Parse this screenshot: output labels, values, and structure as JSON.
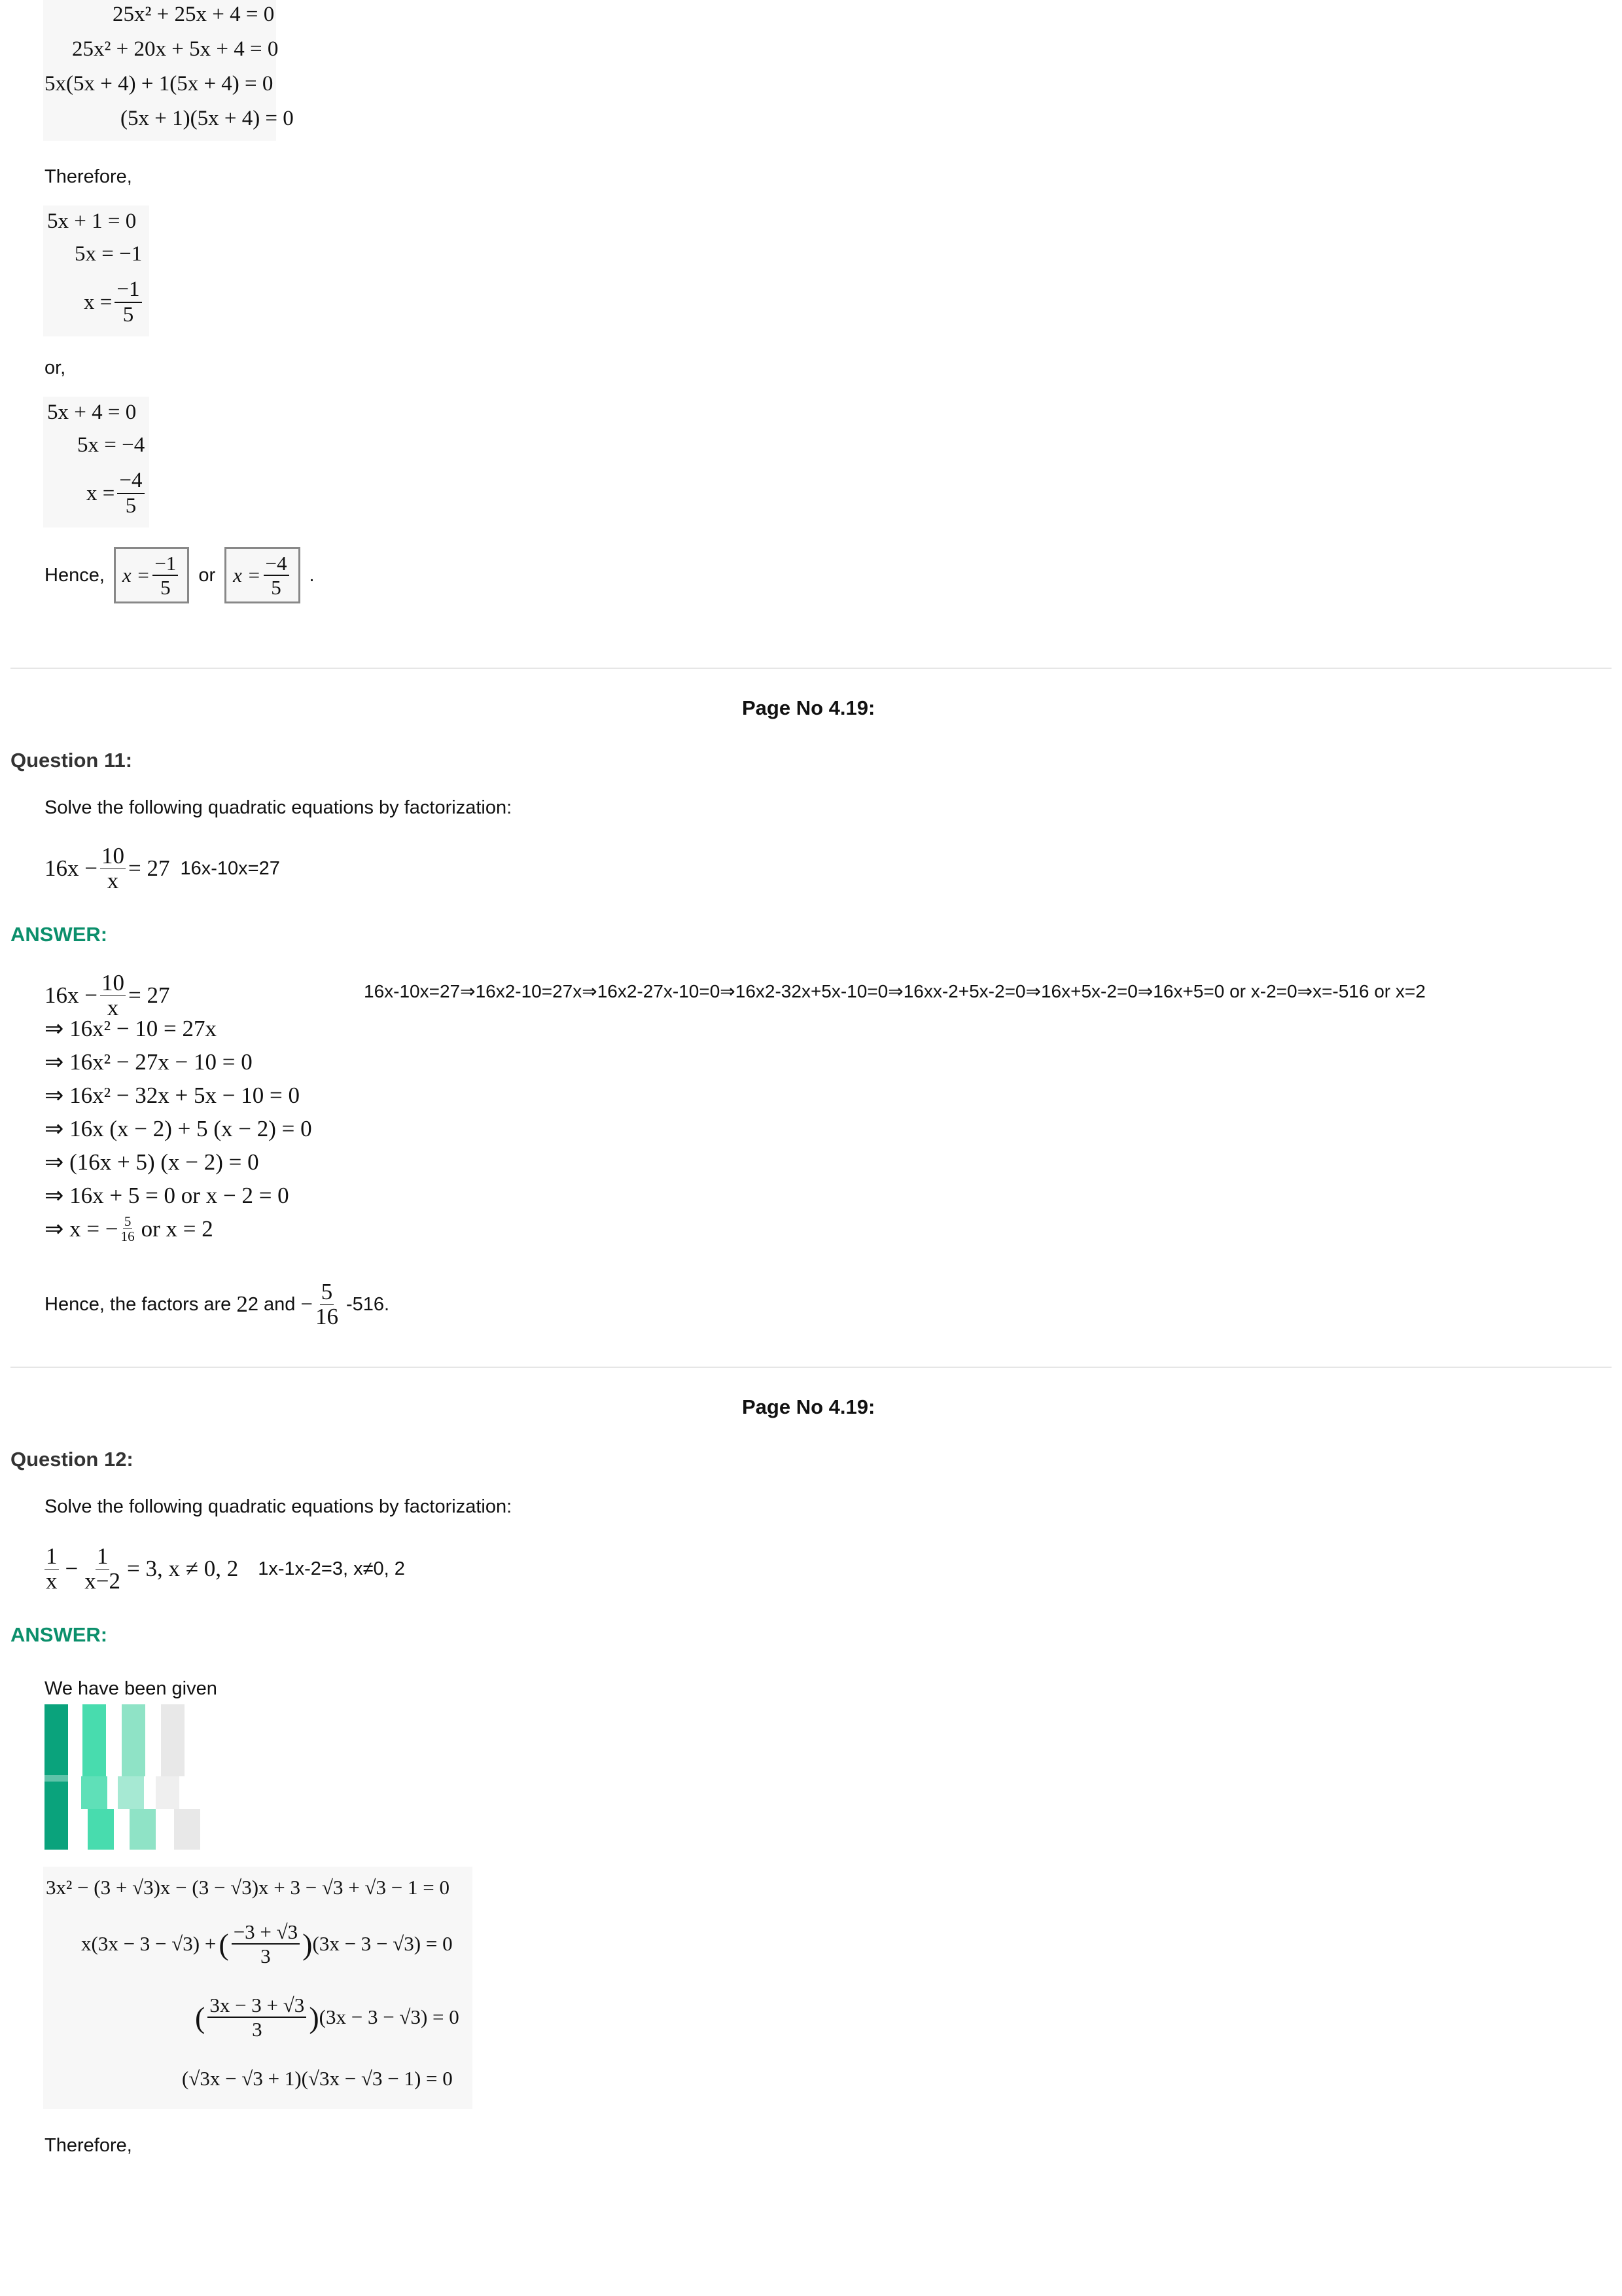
{
  "top_work": {
    "lines": [
      "25x² + 25x + 4 = 0",
      "25x² + 20x + 5x + 4 = 0",
      "5x(5x + 4) + 1(5x + 4) = 0",
      "(5x + 1)(5x + 4) = 0"
    ],
    "therefore": "Therefore,",
    "case1": [
      "5x + 1 = 0",
      "5x = −1",
      "x =",
      "−1",
      "5"
    ],
    "or_text": "or,",
    "case2": [
      "5x + 4 = 0",
      "5x = −4",
      "x =",
      "−4",
      "5"
    ],
    "hence_prefix": "Hence,",
    "hence_or": "or",
    "hence_end": ".",
    "box1": [
      "x =",
      "−1",
      "5"
    ],
    "box2": [
      "x =",
      "−4",
      "5"
    ]
  },
  "q11": {
    "page_no": "Page No 4.19:",
    "heading": "Question 11:",
    "instruction": "Solve the following quadratic equations by factorization:",
    "eq_left": "16x −",
    "eq_num": "10",
    "eq_den": "x",
    "eq_right": "= 27",
    "eq_text": "16x-10x=27",
    "answer_label": "ANSWER:",
    "solution_first_left": "16x −",
    "solution_first_num": "10",
    "solution_first_den": "x",
    "solution_first_right": "= 27",
    "solution_inline": "16x-10x=27⇒16x2-10=27x⇒16x2-27x-10=0⇒16x2-32x+5x-10=0⇒16xx-2+5x-2=0⇒16x+5x-2=0⇒16x+5=0 or x-2=0⇒x=-516 or x=2",
    "steps": [
      "⇒ 16x² − 10 = 27x",
      "⇒ 16x² − 27x − 10 = 0",
      "⇒ 16x² − 32x + 5x − 10 = 0",
      "⇒ 16x (x − 2) + 5 (x − 2) = 0",
      "⇒ (16x + 5) (x − 2) = 0",
      "⇒ 16x + 5 = 0  or  x − 2 = 0"
    ],
    "last_step_prefix": "⇒ x = −",
    "last_step_num": "5",
    "last_step_den": "16",
    "last_step_suffix": "or  x = 2",
    "conclusion_prefix": "Hence, the factors are",
    "conclusion_val1": "2",
    "conclusion_val1_alt": "2",
    "conclusion_and": "and",
    "conclusion_neg": "−",
    "conclusion_num": "5",
    "conclusion_den": "16",
    "conclusion_alt": "-516."
  },
  "q12": {
    "page_no": "Page No 4.19:",
    "heading": "Question 12:",
    "instruction": "Solve the following quadratic equations by factorization:",
    "eq_num1": "1",
    "eq_den1": "x",
    "eq_num2": "1",
    "eq_den2": "x−2",
    "eq_rest": "= 3,  x ≠ 0,  2",
    "eq_text": "1x-1x-2=3, x≠0, 2",
    "answer_label": "ANSWER:",
    "given": "We have been given",
    "work_line1": "3x² − (3 + √3)x − (3 − √3)x + 3 − √3 + √3 − 1 = 0",
    "work_line2_a": "x(3x − 3 − √3) +",
    "work_line2_num": "−3 + √3",
    "work_line2_den": "3",
    "work_line2_b": "(3x − 3 − √3) = 0",
    "work_line3_num": "3x − 3 + √3",
    "work_line3_den": "3",
    "work_line3_b": "(3x − 3 − √3) = 0",
    "work_line4": "(√3x − √3 + 1)(√3x − √3 − 1) = 0",
    "therefore": "Therefore,"
  },
  "colors": {
    "answer_green": "#0b8f6b",
    "teal_dark": "#0aa37c",
    "teal_mid": "#48dcae",
    "teal_light": "#8fe3c6",
    "gray_light": "#e8e8e8"
  }
}
